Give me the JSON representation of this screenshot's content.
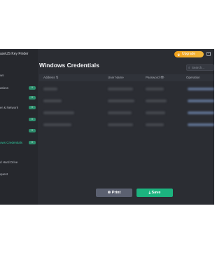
{
  "app": {
    "title": "aseUS Key Finder",
    "upgrade_label": "Upgrade",
    "upgrade_icon": "crown-icon"
  },
  "sidebar": {
    "items": [
      {
        "label": "ws",
        "badge": ""
      },
      {
        "label": "ations",
        "badge": "0"
      },
      {
        "label": "",
        "badge": "0"
      },
      {
        "label": "er & Network",
        "badge": "0"
      },
      {
        "label": "",
        "badge": "0"
      },
      {
        "label": "",
        "badge": "0"
      },
      {
        "label": "ows Credentials",
        "badge": "0",
        "active": true
      },
      {
        "label": "",
        "badge": ""
      },
      {
        "label": "d Hard Drive",
        "badge": ""
      },
      {
        "label": "",
        "badge": ""
      },
      {
        "label": "quest",
        "badge": ""
      }
    ]
  },
  "main": {
    "title": "Windows Credentials",
    "search_placeholder": "Search...",
    "columns": {
      "address": "Address",
      "user_name": "User Name",
      "password": "Password",
      "operation": "Operation"
    }
  },
  "buttons": {
    "print": "Print",
    "save": "Save"
  },
  "colors": {
    "accent": "#1cb37f",
    "upgrade": "#f3a21b",
    "background": "#2b2d33"
  }
}
